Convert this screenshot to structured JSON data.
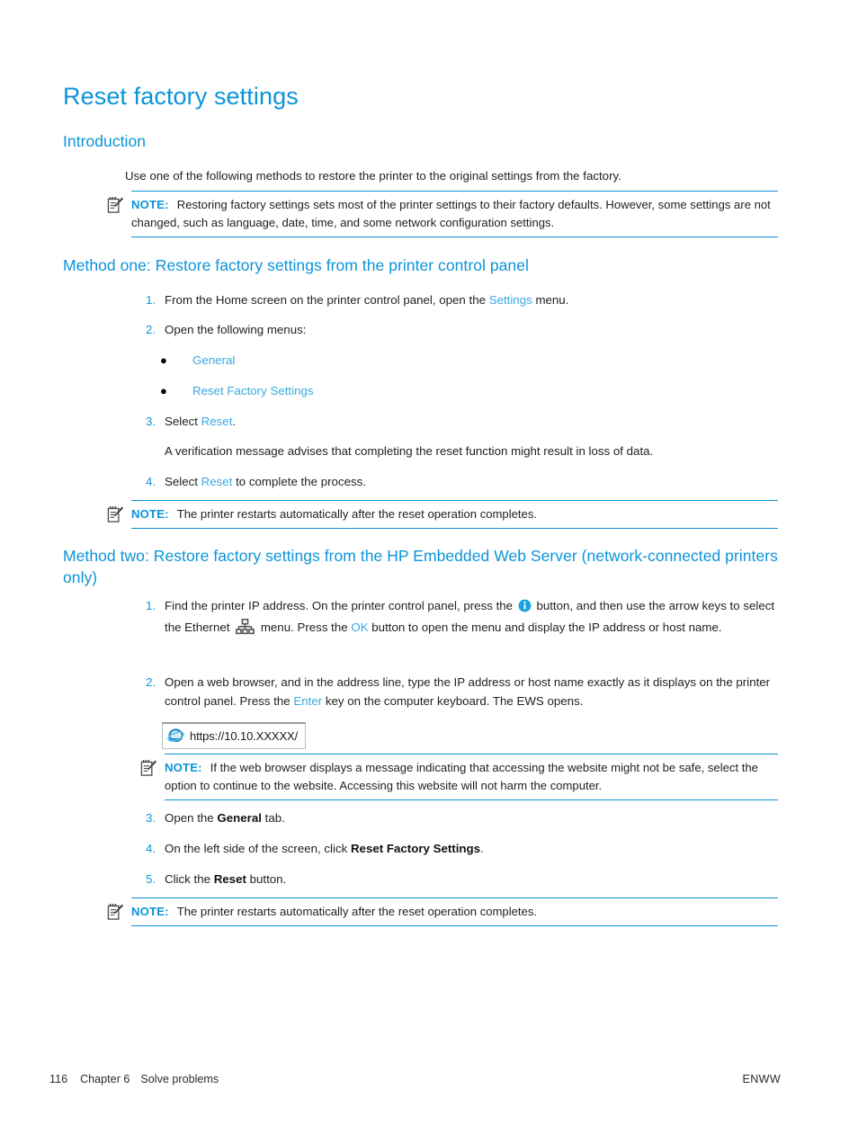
{
  "page": {
    "title": "Reset factory settings",
    "accent_color": "#0B94D9",
    "link_color": "#39A9E0"
  },
  "intro": {
    "heading": "Introduction",
    "paragraph": "Use one of the following methods to restore the printer to the original settings from the factory."
  },
  "note_intro": {
    "label": "NOTE:",
    "text": "Restoring factory settings sets most of the printer settings to their factory defaults. However, some settings are not changed, such as language, date, time, and some network configuration settings."
  },
  "method_one": {
    "heading": "Method one: Restore factory settings from the printer control panel",
    "steps": [
      {
        "num": "1.",
        "before": "From the Home screen on the printer control panel, open the ",
        "link": "Settings",
        "after": " menu."
      },
      {
        "num": "2.",
        "before": "Open the following menus:",
        "link": "",
        "after": ""
      },
      {
        "num": "3.",
        "before": "Select ",
        "link": "Reset",
        "after": "."
      },
      {
        "num": "4.",
        "before": "Select ",
        "link": "Reset",
        "after": " to complete the process."
      }
    ],
    "bullets": [
      "General",
      "Reset Factory Settings"
    ],
    "verification_text": "A verification message advises that completing the reset function might result in loss of data.",
    "note": {
      "label": "NOTE:",
      "text": "The printer restarts automatically after the reset operation completes."
    }
  },
  "method_two": {
    "heading": "Method two: Restore factory settings from the HP Embedded Web Server (network-connected printers only)",
    "step1": {
      "num": "1.",
      "part1": "Find the printer IP address. On the printer control panel, press the ",
      "info_icon": "info-icon",
      "part2": " button, and then use the arrow keys to select the Ethernet ",
      "ethernet_icon": "ethernet-icon",
      "part3": " menu. Press the ",
      "ok_link": "OK",
      "part4": " button to open the menu and display the IP address or host name."
    },
    "step2": {
      "num": "2.",
      "part1": "Open a web browser, and in the address line, type the IP address or host name exactly as it displays on the printer control panel. Press the ",
      "enter_link": "Enter",
      "part2": " key on the computer keyboard. The EWS opens."
    },
    "address_bar": {
      "icon": "internet-explorer-icon",
      "url": "https://10.10.XXXXX/"
    },
    "note_browser": {
      "label": "NOTE:",
      "text": "If the web browser displays a message indicating that accessing the website might not be safe, select the option to continue to the website. Accessing this website will not harm the computer."
    },
    "steps_tail": [
      {
        "num": "3.",
        "before": "Open the ",
        "bold": "General",
        "after": " tab."
      },
      {
        "num": "4.",
        "before": "On the left side of the screen, click ",
        "bold": "Reset Factory Settings",
        "after": "."
      },
      {
        "num": "5.",
        "before": "Click the ",
        "bold": "Reset",
        "after": " button."
      }
    ],
    "note": {
      "label": "NOTE:",
      "text": "The printer restarts automatically after the reset operation completes."
    }
  },
  "footer": {
    "page_number": "116",
    "chapter": "Chapter 6",
    "chapter_title": "Solve problems",
    "language": "ENWW"
  }
}
